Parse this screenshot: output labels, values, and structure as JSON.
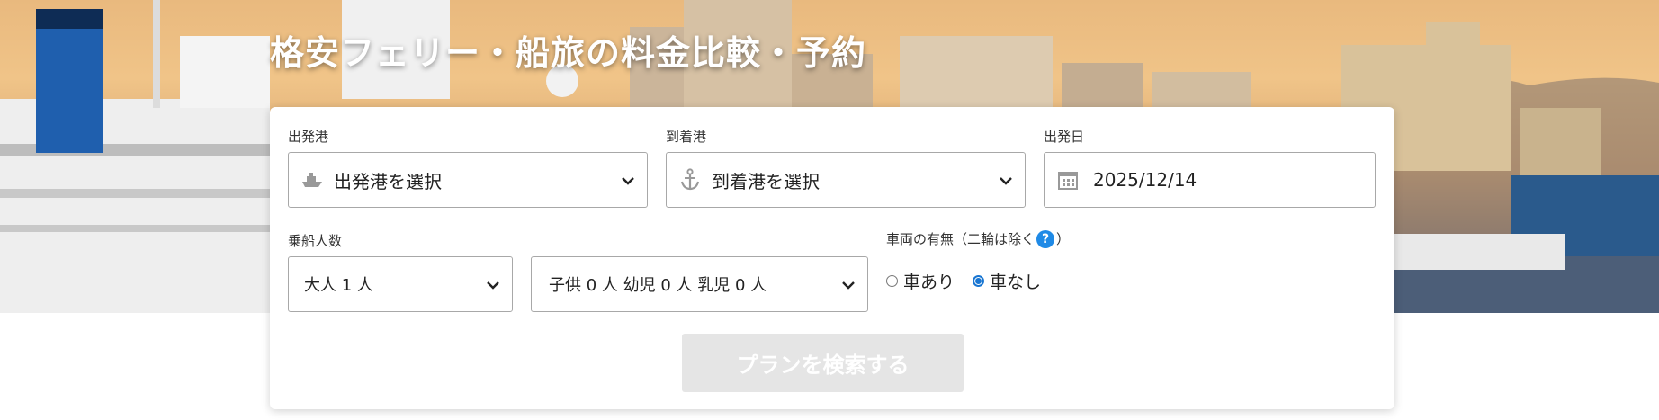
{
  "hero": {
    "title": "格安フェリー・船旅の料金比較・予約"
  },
  "search": {
    "departure": {
      "label": "出発港",
      "value": "出発港を選択",
      "icon": "ship-icon"
    },
    "arrival": {
      "label": "到着港",
      "value": "到着港を選択",
      "icon": "anchor-icon"
    },
    "date": {
      "label": "出発日",
      "value": "2025/12/14",
      "icon": "calendar-icon"
    },
    "passengers": {
      "label": "乗船人数",
      "adults": "大人 1 人",
      "others": "子供 0 人 幼児 0 人 乳児 0 人"
    },
    "vehicle": {
      "label": "車両の有無（二輪は除く",
      "label_close": "）",
      "help": "?",
      "options": [
        "車あり",
        "車なし"
      ],
      "selected": "車なし"
    },
    "submit_label": "プランを検索する"
  },
  "colors": {
    "accent": "#1f8ae6",
    "radio_selected": "#1976d2",
    "button_disabled": "#e5e5e5"
  }
}
